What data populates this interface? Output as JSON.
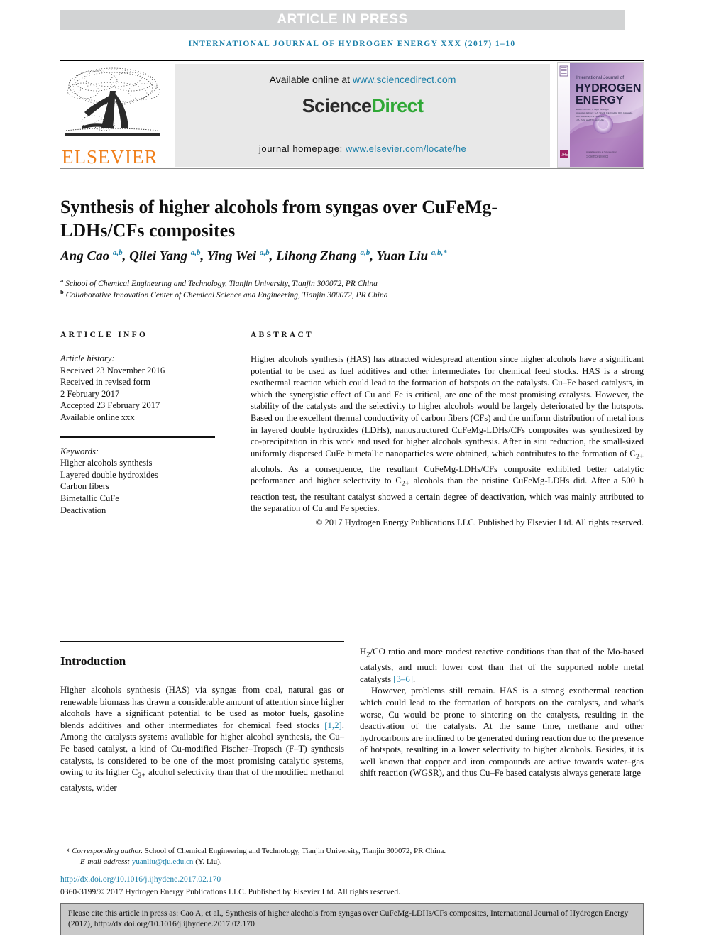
{
  "banner": {
    "article_in_press": "ARTICLE IN PRESS",
    "journal_line": "International Journal of Hydrogen Energy xxx (2017) 1–10"
  },
  "masthead": {
    "publisher": "ELSEVIER",
    "available_prefix": "Available online at ",
    "available_link": "www.sciencedirect.com",
    "sciencedirect_part1": "Science",
    "sciencedirect_part2": "Direct",
    "homepage_label": "journal homepage: ",
    "homepage_link": "www.elsevier.com/locate/he",
    "cover_line1": "International Journal of",
    "cover_line2": "HYDROGEN",
    "cover_line3": "ENERGY",
    "cover_editors": "Editors-in-Chief: T. Nejat Veziroglu; Associate Editors: S.A. Sherif, P.E. Dodds, R.K. Ahluwalia, A.C. Messina, J.W. Sheffield, J.A. Turk, and T.N. Veziroglu",
    "cover_footer": "Available online at ScienceDirect"
  },
  "article": {
    "title": "Synthesis of higher alcohols from syngas over CuFeMg-LDHs/CFs composites",
    "authors_html": "Ang Cao <sup>a,b</sup>, Qilei Yang <sup>a,b</sup>, Ying Wei <sup>a,b</sup>, Lihong Zhang <sup>a,b</sup>, Yuan Liu <sup>a,b,*</sup>",
    "affiliation_a": "School of Chemical Engineering and Technology, Tianjin University, Tianjin 300072, PR China",
    "affiliation_b": "Collaborative Innovation Center of Chemical Science and Engineering, Tianjin 300072, PR China"
  },
  "article_info": {
    "heading": "ARTICLE INFO",
    "history_label": "Article history:",
    "history": [
      "Received 23 November 2016",
      "Received in revised form",
      "2 February 2017",
      "Accepted 23 February 2017",
      "Available online xxx"
    ],
    "keywords_label": "Keywords:",
    "keywords": [
      "Higher alcohols synthesis",
      "Layered double hydroxides",
      "Carbon fibers",
      "Bimetallic CuFe",
      "Deactivation"
    ]
  },
  "abstract": {
    "heading": "ABSTRACT",
    "text": "Higher alcohols synthesis (HAS) has attracted widespread attention since higher alcohols have a significant potential to be used as fuel additives and other intermediates for chemical feed stocks. HAS is a strong exothermal reaction which could lead to the formation of hotspots on the catalysts. Cu–Fe based catalysts, in which the synergistic effect of Cu and Fe is critical, are one of the most promising catalysts. However, the stability of the catalysts and the selectivity to higher alcohols would be largely deteriorated by the hotspots. Based on the excellent thermal conductivity of carbon fibers (CFs) and the uniform distribution of metal ions in layered double hydroxides (LDHs), nanostructured CuFeMg-LDHs/CFs composites was synthesized by co-precipitation in this work and used for higher alcohols synthesis. After in situ reduction, the small-sized uniformly dispersed CuFe bimetallic nanoparticles were obtained, which contributes to the formation of C",
    "text_sub1": "2+",
    "text_cont1": " alcohols. As a consequence, the resultant CuFeMg-LDHs/CFs composite exhibited better catalytic performance and higher selectivity to C",
    "text_sub2": "2+",
    "text_cont2": " alcohols than the pristine CuFeMg-LDHs did. After a 500 h reaction test, the resultant catalyst showed a certain degree of deactivation, which was mainly attributed to the separation of Cu and Fe species.",
    "copyright": "© 2017 Hydrogen Energy Publications LLC. Published by Elsevier Ltd. All rights reserved."
  },
  "introduction": {
    "heading": "Introduction",
    "left_p1_a": "Higher alcohols synthesis (HAS) via syngas from coal, natural gas or renewable biomass has drawn a considerable amount of attention since higher alcohols have a significant potential to be used as motor fuels, gasoline blends additives and other intermediates for chemical feed stocks ",
    "left_p1_ref": "[1,2]",
    "left_p1_b": ". Among the catalysts systems available for higher alcohol synthesis, the Cu–Fe based catalyst, a kind of Cu-modified Fischer–Tropsch (F–T) synthesis catalysts, is considered to be one of the most promising catalytic systems, owing to its higher C",
    "left_p1_sub": "2+",
    "left_p1_c": " alcohol selectivity than that of the modified methanol catalysts, wider",
    "right_p1_a": "H",
    "right_p1_sub": "2",
    "right_p1_b": "/CO ratio and more modest reactive conditions than that of the Mo-based catalysts, and much lower cost than that of the supported noble metal catalysts ",
    "right_p1_ref": "[3–6]",
    "right_p1_c": ".",
    "right_p2": "However, problems still remain. HAS is a strong exothermal reaction which could lead to the formation of hotspots on the catalysts, and what's worse, Cu would be prone to sintering on the catalysts, resulting in the deactivation of the catalysts. At the same time, methane and other hydrocarbons are inclined to be generated during reaction due to the presence of hotspots, resulting in a lower selectivity to higher alcohols. Besides, it is well known that copper and iron compounds are active towards water–gas shift reaction (WGSR), and thus Cu–Fe based catalysts always generate large"
  },
  "footnotes": {
    "corresponding_label": "Corresponding author.",
    "corresponding_rest": " School of Chemical Engineering and Technology, Tianjin University, Tianjin 300072, PR China.",
    "email_label": "E-mail address: ",
    "email_link": "yuanliu@tju.edu.cn",
    "email_suffix": " (Y. Liu).",
    "doi": "http://dx.doi.org/10.1016/j.ijhydene.2017.02.170",
    "issn": "0360-3199/© 2017 Hydrogen Energy Publications LLC. Published by Elsevier Ltd. All rights reserved."
  },
  "cite_box": {
    "text": "Please cite this article in press as: Cao A, et al., Synthesis of higher alcohols from syngas over CuFeMg-LDHs/CFs composites, International Journal of Hydrogen Energy (2017), http://dx.doi.org/10.1016/j.ijhydene.2017.02.170"
  },
  "colors": {
    "accent_blue": "#1a7fa8",
    "elsevier_orange": "#f07f1a",
    "sciencedirect_green": "#2fa836",
    "bar_gray": "#d2d3d4",
    "cite_gray": "#c9c9c9"
  }
}
